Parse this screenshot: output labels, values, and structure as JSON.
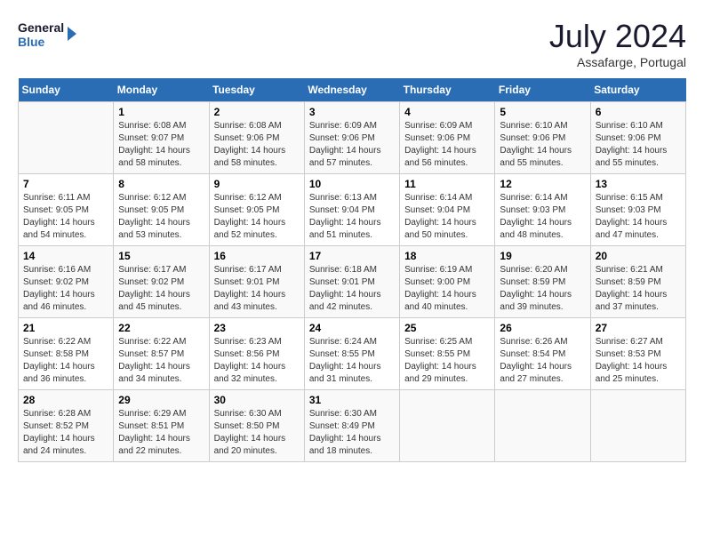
{
  "logo": {
    "line1": "General",
    "line2": "Blue"
  },
  "title": "July 2024",
  "subtitle": "Assafarge, Portugal",
  "days_of_week": [
    "Sunday",
    "Monday",
    "Tuesday",
    "Wednesday",
    "Thursday",
    "Friday",
    "Saturday"
  ],
  "weeks": [
    [
      {
        "day": "",
        "info": ""
      },
      {
        "day": "1",
        "info": "Sunrise: 6:08 AM\nSunset: 9:07 PM\nDaylight: 14 hours\nand 58 minutes."
      },
      {
        "day": "2",
        "info": "Sunrise: 6:08 AM\nSunset: 9:06 PM\nDaylight: 14 hours\nand 58 minutes."
      },
      {
        "day": "3",
        "info": "Sunrise: 6:09 AM\nSunset: 9:06 PM\nDaylight: 14 hours\nand 57 minutes."
      },
      {
        "day": "4",
        "info": "Sunrise: 6:09 AM\nSunset: 9:06 PM\nDaylight: 14 hours\nand 56 minutes."
      },
      {
        "day": "5",
        "info": "Sunrise: 6:10 AM\nSunset: 9:06 PM\nDaylight: 14 hours\nand 55 minutes."
      },
      {
        "day": "6",
        "info": "Sunrise: 6:10 AM\nSunset: 9:06 PM\nDaylight: 14 hours\nand 55 minutes."
      }
    ],
    [
      {
        "day": "7",
        "info": "Sunrise: 6:11 AM\nSunset: 9:05 PM\nDaylight: 14 hours\nand 54 minutes."
      },
      {
        "day": "8",
        "info": "Sunrise: 6:12 AM\nSunset: 9:05 PM\nDaylight: 14 hours\nand 53 minutes."
      },
      {
        "day": "9",
        "info": "Sunrise: 6:12 AM\nSunset: 9:05 PM\nDaylight: 14 hours\nand 52 minutes."
      },
      {
        "day": "10",
        "info": "Sunrise: 6:13 AM\nSunset: 9:04 PM\nDaylight: 14 hours\nand 51 minutes."
      },
      {
        "day": "11",
        "info": "Sunrise: 6:14 AM\nSunset: 9:04 PM\nDaylight: 14 hours\nand 50 minutes."
      },
      {
        "day": "12",
        "info": "Sunrise: 6:14 AM\nSunset: 9:03 PM\nDaylight: 14 hours\nand 48 minutes."
      },
      {
        "day": "13",
        "info": "Sunrise: 6:15 AM\nSunset: 9:03 PM\nDaylight: 14 hours\nand 47 minutes."
      }
    ],
    [
      {
        "day": "14",
        "info": "Sunrise: 6:16 AM\nSunset: 9:02 PM\nDaylight: 14 hours\nand 46 minutes."
      },
      {
        "day": "15",
        "info": "Sunrise: 6:17 AM\nSunset: 9:02 PM\nDaylight: 14 hours\nand 45 minutes."
      },
      {
        "day": "16",
        "info": "Sunrise: 6:17 AM\nSunset: 9:01 PM\nDaylight: 14 hours\nand 43 minutes."
      },
      {
        "day": "17",
        "info": "Sunrise: 6:18 AM\nSunset: 9:01 PM\nDaylight: 14 hours\nand 42 minutes."
      },
      {
        "day": "18",
        "info": "Sunrise: 6:19 AM\nSunset: 9:00 PM\nDaylight: 14 hours\nand 40 minutes."
      },
      {
        "day": "19",
        "info": "Sunrise: 6:20 AM\nSunset: 8:59 PM\nDaylight: 14 hours\nand 39 minutes."
      },
      {
        "day": "20",
        "info": "Sunrise: 6:21 AM\nSunset: 8:59 PM\nDaylight: 14 hours\nand 37 minutes."
      }
    ],
    [
      {
        "day": "21",
        "info": "Sunrise: 6:22 AM\nSunset: 8:58 PM\nDaylight: 14 hours\nand 36 minutes."
      },
      {
        "day": "22",
        "info": "Sunrise: 6:22 AM\nSunset: 8:57 PM\nDaylight: 14 hours\nand 34 minutes."
      },
      {
        "day": "23",
        "info": "Sunrise: 6:23 AM\nSunset: 8:56 PM\nDaylight: 14 hours\nand 32 minutes."
      },
      {
        "day": "24",
        "info": "Sunrise: 6:24 AM\nSunset: 8:55 PM\nDaylight: 14 hours\nand 31 minutes."
      },
      {
        "day": "25",
        "info": "Sunrise: 6:25 AM\nSunset: 8:55 PM\nDaylight: 14 hours\nand 29 minutes."
      },
      {
        "day": "26",
        "info": "Sunrise: 6:26 AM\nSunset: 8:54 PM\nDaylight: 14 hours\nand 27 minutes."
      },
      {
        "day": "27",
        "info": "Sunrise: 6:27 AM\nSunset: 8:53 PM\nDaylight: 14 hours\nand 25 minutes."
      }
    ],
    [
      {
        "day": "28",
        "info": "Sunrise: 6:28 AM\nSunset: 8:52 PM\nDaylight: 14 hours\nand 24 minutes."
      },
      {
        "day": "29",
        "info": "Sunrise: 6:29 AM\nSunset: 8:51 PM\nDaylight: 14 hours\nand 22 minutes."
      },
      {
        "day": "30",
        "info": "Sunrise: 6:30 AM\nSunset: 8:50 PM\nDaylight: 14 hours\nand 20 minutes."
      },
      {
        "day": "31",
        "info": "Sunrise: 6:30 AM\nSunset: 8:49 PM\nDaylight: 14 hours\nand 18 minutes."
      },
      {
        "day": "",
        "info": ""
      },
      {
        "day": "",
        "info": ""
      },
      {
        "day": "",
        "info": ""
      }
    ]
  ]
}
